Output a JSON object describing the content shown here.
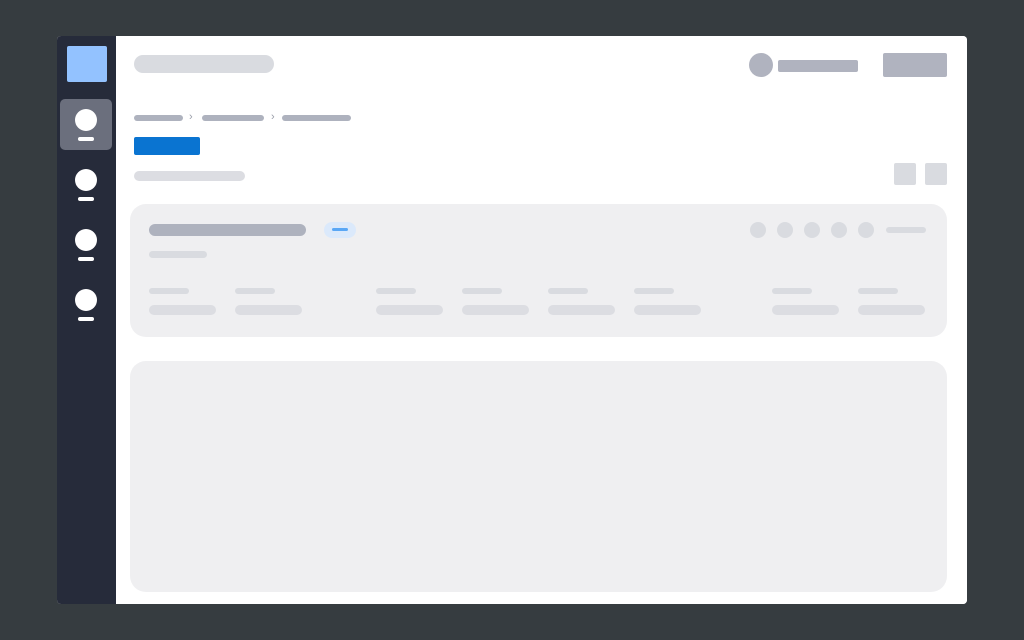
{
  "app": {
    "screen_text": ""
  },
  "colors": {
    "background": "#363c40",
    "sidebar": "#262b3a",
    "sidebar_active": "#6b6f7d",
    "logo": "#93c2ff",
    "primary": "#0a74d1",
    "tag_background": "#dbe9fb",
    "tag_accent": "#5aa7f5",
    "card": "#efeff1",
    "skeleton_dark": "#aeb2be",
    "skeleton_light": "#d9dbe0"
  },
  "sidebar": {
    "logo_icon": "app-logo",
    "items": [
      {
        "icon": "nav-circle-icon",
        "active": true
      },
      {
        "icon": "nav-circle-icon",
        "active": false
      },
      {
        "icon": "nav-circle-icon",
        "active": false
      },
      {
        "icon": "nav-circle-icon",
        "active": false
      }
    ]
  },
  "header": {
    "search_placeholder": "",
    "avatar_icon": "avatar-circle",
    "user_name": "",
    "action_label": ""
  },
  "breadcrumbs": [
    "",
    "",
    ""
  ],
  "toolbar": {
    "primary_label": "",
    "subtitle": "",
    "view_buttons": [
      "grid-view-icon",
      "list-view-icon"
    ]
  },
  "summary_card": {
    "title": "",
    "tag": "",
    "subtitle": "",
    "status_dots": 5,
    "status_label": "",
    "fields": [
      {
        "label": "",
        "value": ""
      },
      {
        "label": "",
        "value": ""
      },
      {
        "label": "",
        "value": ""
      },
      {
        "label": "",
        "value": ""
      },
      {
        "label": "",
        "value": ""
      },
      {
        "label": "",
        "value": ""
      },
      {
        "label": "",
        "value": ""
      },
      {
        "label": "",
        "value": ""
      }
    ]
  },
  "content_panel": {
    "body": ""
  }
}
